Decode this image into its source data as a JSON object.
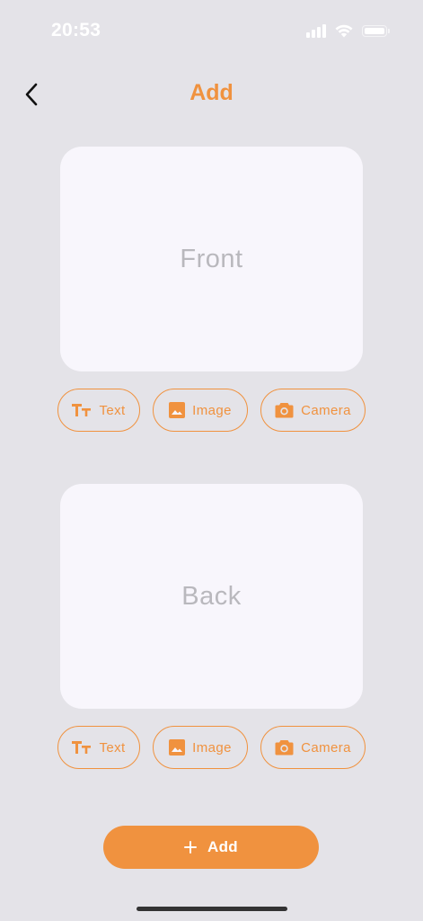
{
  "status_bar": {
    "time": "20:53"
  },
  "header": {
    "title": "Add",
    "back_icon": "chevron-left-icon"
  },
  "front_card": {
    "placeholder": "Front",
    "actions": [
      {
        "label": "Text",
        "icon": "text-format-icon"
      },
      {
        "label": "Image",
        "icon": "image-icon"
      },
      {
        "label": "Camera",
        "icon": "camera-icon"
      }
    ]
  },
  "back_card": {
    "placeholder": "Back",
    "actions": [
      {
        "label": "Text",
        "icon": "text-format-icon"
      },
      {
        "label": "Image",
        "icon": "image-icon"
      },
      {
        "label": "Camera",
        "icon": "camera-icon"
      }
    ]
  },
  "footer": {
    "add_label": "Add",
    "add_icon": "plus-icon"
  },
  "colors": {
    "accent": "#f0923f",
    "background": "#e4e3e8",
    "card": "#f8f6fc",
    "placeholder_text": "#b9b8bd"
  }
}
